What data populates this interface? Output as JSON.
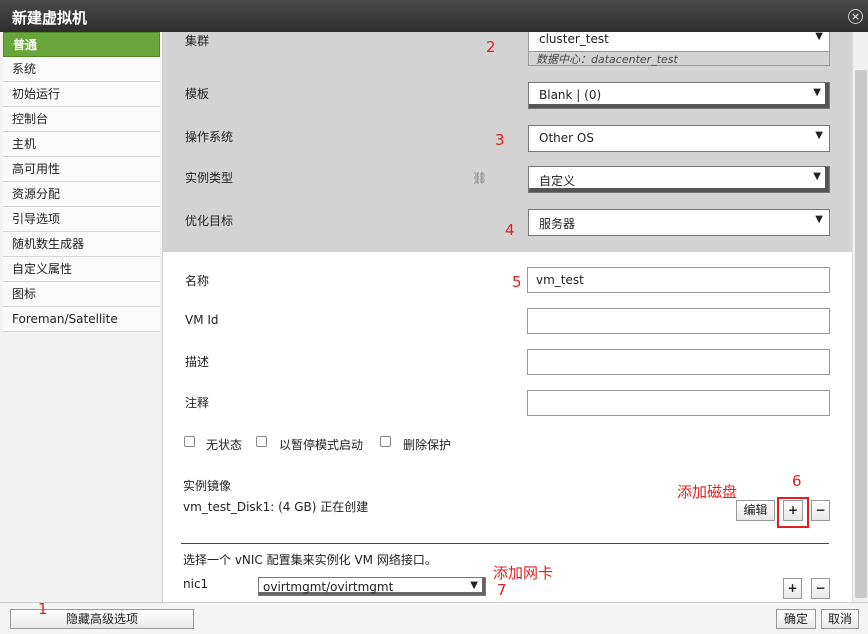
{
  "dialog": {
    "title": "新建虚拟机",
    "close_glyph": "×"
  },
  "sidebar": {
    "items": [
      {
        "label": "普通"
      },
      {
        "label": "系统"
      },
      {
        "label": "初始运行"
      },
      {
        "label": "控制台"
      },
      {
        "label": "主机"
      },
      {
        "label": "高可用性"
      },
      {
        "label": "资源分配"
      },
      {
        "label": "引导选项"
      },
      {
        "label": "随机数生成器"
      },
      {
        "label": "自定义属性"
      },
      {
        "label": "图标"
      },
      {
        "label": "Foreman/Satellite"
      }
    ]
  },
  "general": {
    "cluster_label": "集群",
    "cluster_value": "cluster_test",
    "cluster_sub": "数据中心：datacenter_test",
    "template_label": "模板",
    "template_value": "Blank | (0)",
    "os_label": "操作系统",
    "os_value": "Other OS",
    "instance_type_label": "实例类型",
    "instance_type_value": "自定义",
    "optimize_label": "优化目标",
    "optimize_value": "服务器",
    "name_label": "名称",
    "name_value": "vm_test",
    "vmid_label": "VM Id",
    "vmid_value": "",
    "desc_label": "描述",
    "desc_value": "",
    "comment_label": "注释",
    "comment_value": "",
    "stateless_label": "无状态",
    "paused_label": "以暂停模式启动",
    "delete_protect_label": "删除保护",
    "images_label": "实例镜像",
    "disk_text": "vm_test_Disk1: (4 GB) 正在创建",
    "edit_button": "编辑",
    "plus": "+",
    "minus": "−",
    "nic_instruction": "选择一个 vNIC 配置集来实例化 VM 网络接口。",
    "nic_label": "nic1",
    "nic_value": "ovirtmgmt/ovirtmgmt"
  },
  "annotations": {
    "n1": "1",
    "n2": "2",
    "n3": "3",
    "n4": "4",
    "n5": "5",
    "n6": "6",
    "n7": "7",
    "add_disk": "添加磁盘",
    "add_nic": "添加网卡"
  },
  "footer": {
    "hide_advanced": "隐藏高级选项",
    "ok": "确定",
    "cancel": "取消"
  },
  "icons": {
    "arrow": "▼",
    "link_icon": "⛓"
  }
}
